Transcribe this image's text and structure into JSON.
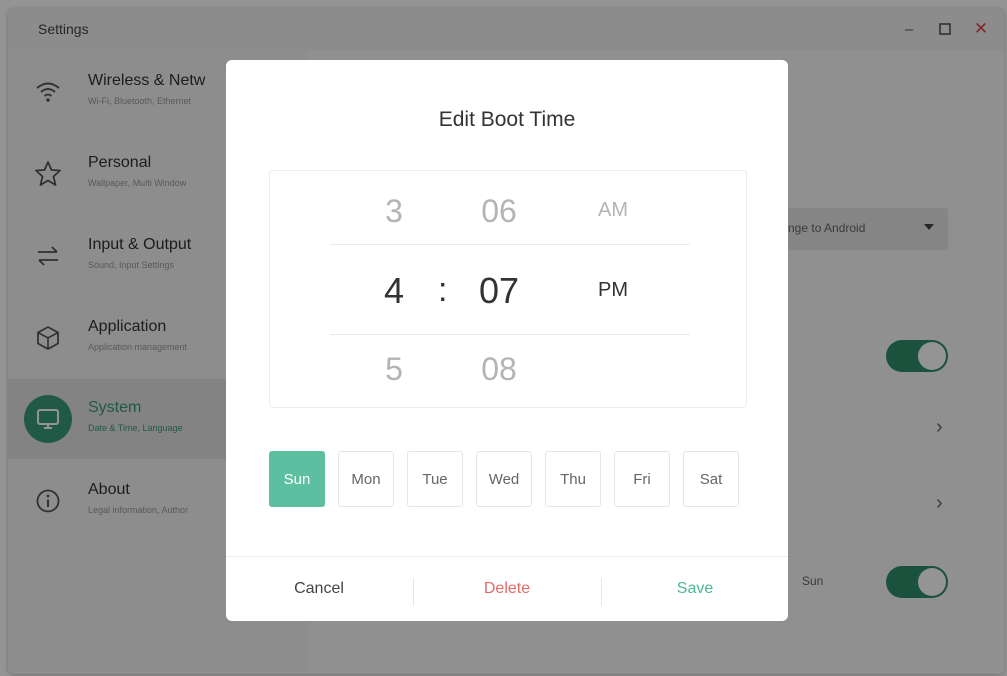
{
  "window": {
    "title": "Settings"
  },
  "sidebar": {
    "items": [
      {
        "title": "Wireless & Netw",
        "subtitle": "Wi-Fi, Bluetooth, Ethernet",
        "icon": "wifi-icon"
      },
      {
        "title": "Personal",
        "subtitle": "Wallpaper, Multi Window",
        "icon": "star-icon"
      },
      {
        "title": "Input & Output",
        "subtitle": "Sound, Input Settings",
        "icon": "swap-arrows-icon"
      },
      {
        "title": "Application",
        "subtitle": "Application management",
        "icon": "cube-icon"
      },
      {
        "title": "System",
        "subtitle": "Date & Time, Language",
        "icon": "monitor-icon",
        "active": true
      },
      {
        "title": "About",
        "subtitle": "Legal information, Author",
        "icon": "info-icon"
      }
    ]
  },
  "content": {
    "dropdown_value": "nge to Android",
    "row_label_sun": "Sun"
  },
  "dialog": {
    "title": "Edit Boot Time",
    "hours": [
      "3",
      "4",
      "5"
    ],
    "minutes": [
      "06",
      "07",
      "08"
    ],
    "ampm": [
      "AM",
      "PM"
    ],
    "colon": ":",
    "days": [
      "Sun",
      "Mon",
      "Tue",
      "Wed",
      "Thu",
      "Fri",
      "Sat"
    ],
    "selected_day": "Sun",
    "cancel_label": "Cancel",
    "delete_label": "Delete",
    "save_label": "Save"
  },
  "colors": {
    "accent": "#3a9a7a",
    "day_selected": "#5cc0a0",
    "delete": "#e46a6a",
    "save": "#4cb893"
  }
}
